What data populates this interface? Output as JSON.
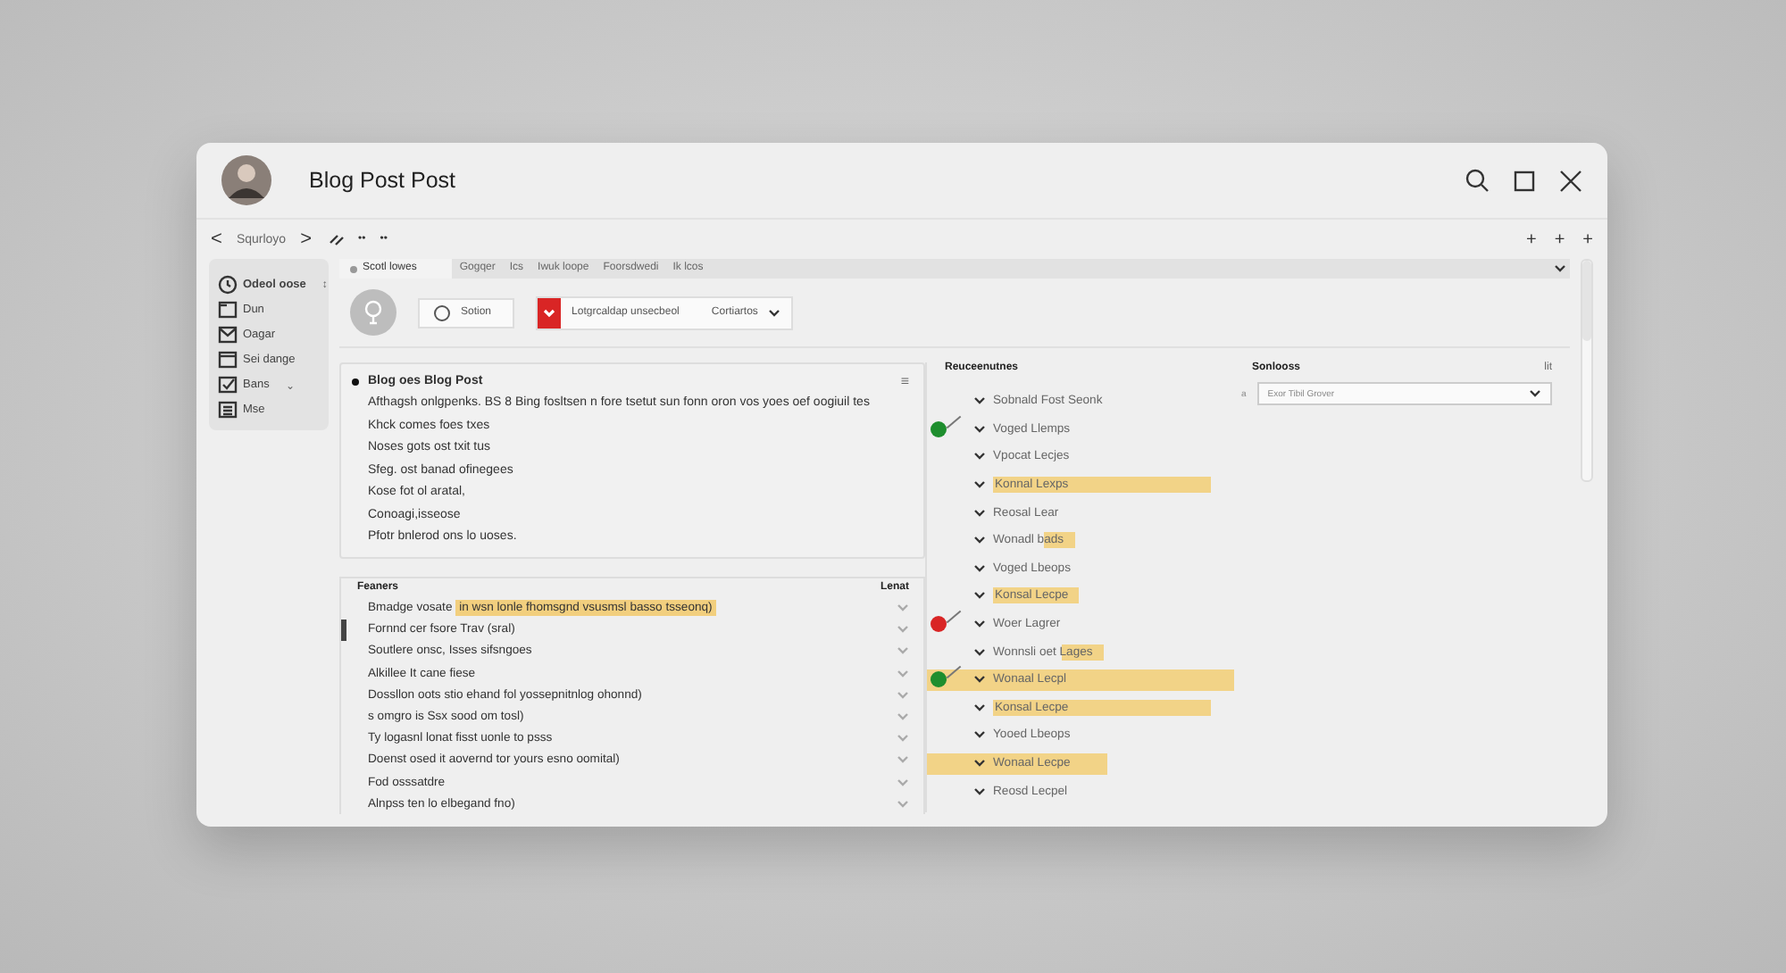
{
  "window": {
    "title": "Blog Post Post"
  },
  "toolbar": {
    "back": "<",
    "label": "Squrloyo",
    "forward": ">",
    "dots": [
      "••",
      "••"
    ],
    "plus": [
      "+",
      "+",
      "+"
    ]
  },
  "sidebar": {
    "items": [
      {
        "label": "Odeol oose",
        "extra": "↕",
        "selected": true
      },
      {
        "label": "Dun",
        "selected": false
      },
      {
        "label": "Oagar",
        "selected": false
      },
      {
        "label": "Sei dange",
        "selected": false
      },
      {
        "label": "Bans",
        "extra": "⌄",
        "selected": false
      },
      {
        "label": "Mse",
        "selected": false
      }
    ]
  },
  "tabs": [
    {
      "label": "Scotl lowes",
      "selected": true
    },
    {
      "label": "Gogqer",
      "selected": false
    },
    {
      "label": "Ics",
      "selected": false
    },
    {
      "label": "Iwuk loope",
      "selected": false
    },
    {
      "label": "Foorsdwedi",
      "selected": false
    },
    {
      "label": "Ik lcos",
      "selected": false
    }
  ],
  "controls": {
    "option": {
      "label": "Sotion",
      "checked": false
    },
    "field": {
      "value": "Lotgrcaldap unsecbeol"
    },
    "dropdown": {
      "label": "Cortiartos"
    }
  },
  "post": {
    "title": "Blog oes Blog Post",
    "lines": [
      "Afthagsh onlgpenks. BS 8 Bing fosltsen n fore tsetut sun fonn oron vos yoes oef oogiuil tes",
      "Khck comes foes txes",
      "Noses gots ost txit tus",
      "Sfeg. ost banad ofinegees",
      "Kose fot ol aratal,",
      "Conoagi,isseose",
      "Pfotr bnlerod ons lo uoses."
    ],
    "menu": "≡"
  },
  "features": {
    "heading": "Feaners",
    "column": "Lenat",
    "rows": [
      {
        "text": "Bmadge vosate ",
        "marked": "in wsn lonle fhomsgnd vsusmsl basso tsseonq)",
        "selected": false
      },
      {
        "text": "Fornnd cer fsore Trav (sral)",
        "selected": true
      },
      {
        "text": "Soutlere onsc, Isses sifsngoes",
        "selected": false
      },
      {
        "text": "Alkillee It cane fiese",
        "selected": false
      },
      {
        "text": "Dossllon oots stio ehand fol yossepnitnlog ohonnd)",
        "selected": false
      },
      {
        "text": "s omgro is Ssx sood om tosl)",
        "selected": false
      },
      {
        "text": "Ty logasnl lonat fisst uonle to psss",
        "selected": false
      },
      {
        "text": "Doenst osed it aovernd tor yours esno oomital)",
        "selected": false
      },
      {
        "text": "Fod osssatdre",
        "selected": false
      },
      {
        "text": "Alnpss ten lo elbegand fno)",
        "selected": false
      }
    ]
  },
  "tree": {
    "heading": "Reuceenutnes",
    "items": [
      {
        "label": "Sobnald Fost Seonk",
        "kind": "plain"
      },
      {
        "label": "Voged Llemps",
        "kind": "plain",
        "color": "#1e8e2e"
      },
      {
        "label": "Vpocat Lecjes",
        "kind": "plain"
      },
      {
        "label": "Konnal Lexps",
        "kind": "wide"
      },
      {
        "label": "Reosal Lear",
        "kind": "plain"
      },
      {
        "label": "Wonadl bads",
        "kind": "tail"
      },
      {
        "label": "Voged Lbeops",
        "kind": "plain"
      },
      {
        "label": "Konsal Lecpe",
        "kind": "short"
      },
      {
        "label": "Woer Lagrer",
        "kind": "plain",
        "color": "#d92525"
      },
      {
        "label": "Wonnsli oet Lages",
        "kind": "tail"
      },
      {
        "label": "Wonaal Lecpl",
        "kind": "row",
        "color": "#1e8e2e"
      },
      {
        "label": "Konsal Lecpe",
        "kind": "wide"
      },
      {
        "label": "Yooed Lbeops",
        "kind": "plain"
      },
      {
        "label": "Wonaal Lecpe",
        "kind": "rowshort"
      },
      {
        "label": "Reosd Lecpel",
        "kind": "plain"
      }
    ]
  },
  "settings": {
    "heading": "Sonlooss",
    "mark": "a",
    "select": "Exor Tibil Grover",
    "corner": "lit"
  }
}
